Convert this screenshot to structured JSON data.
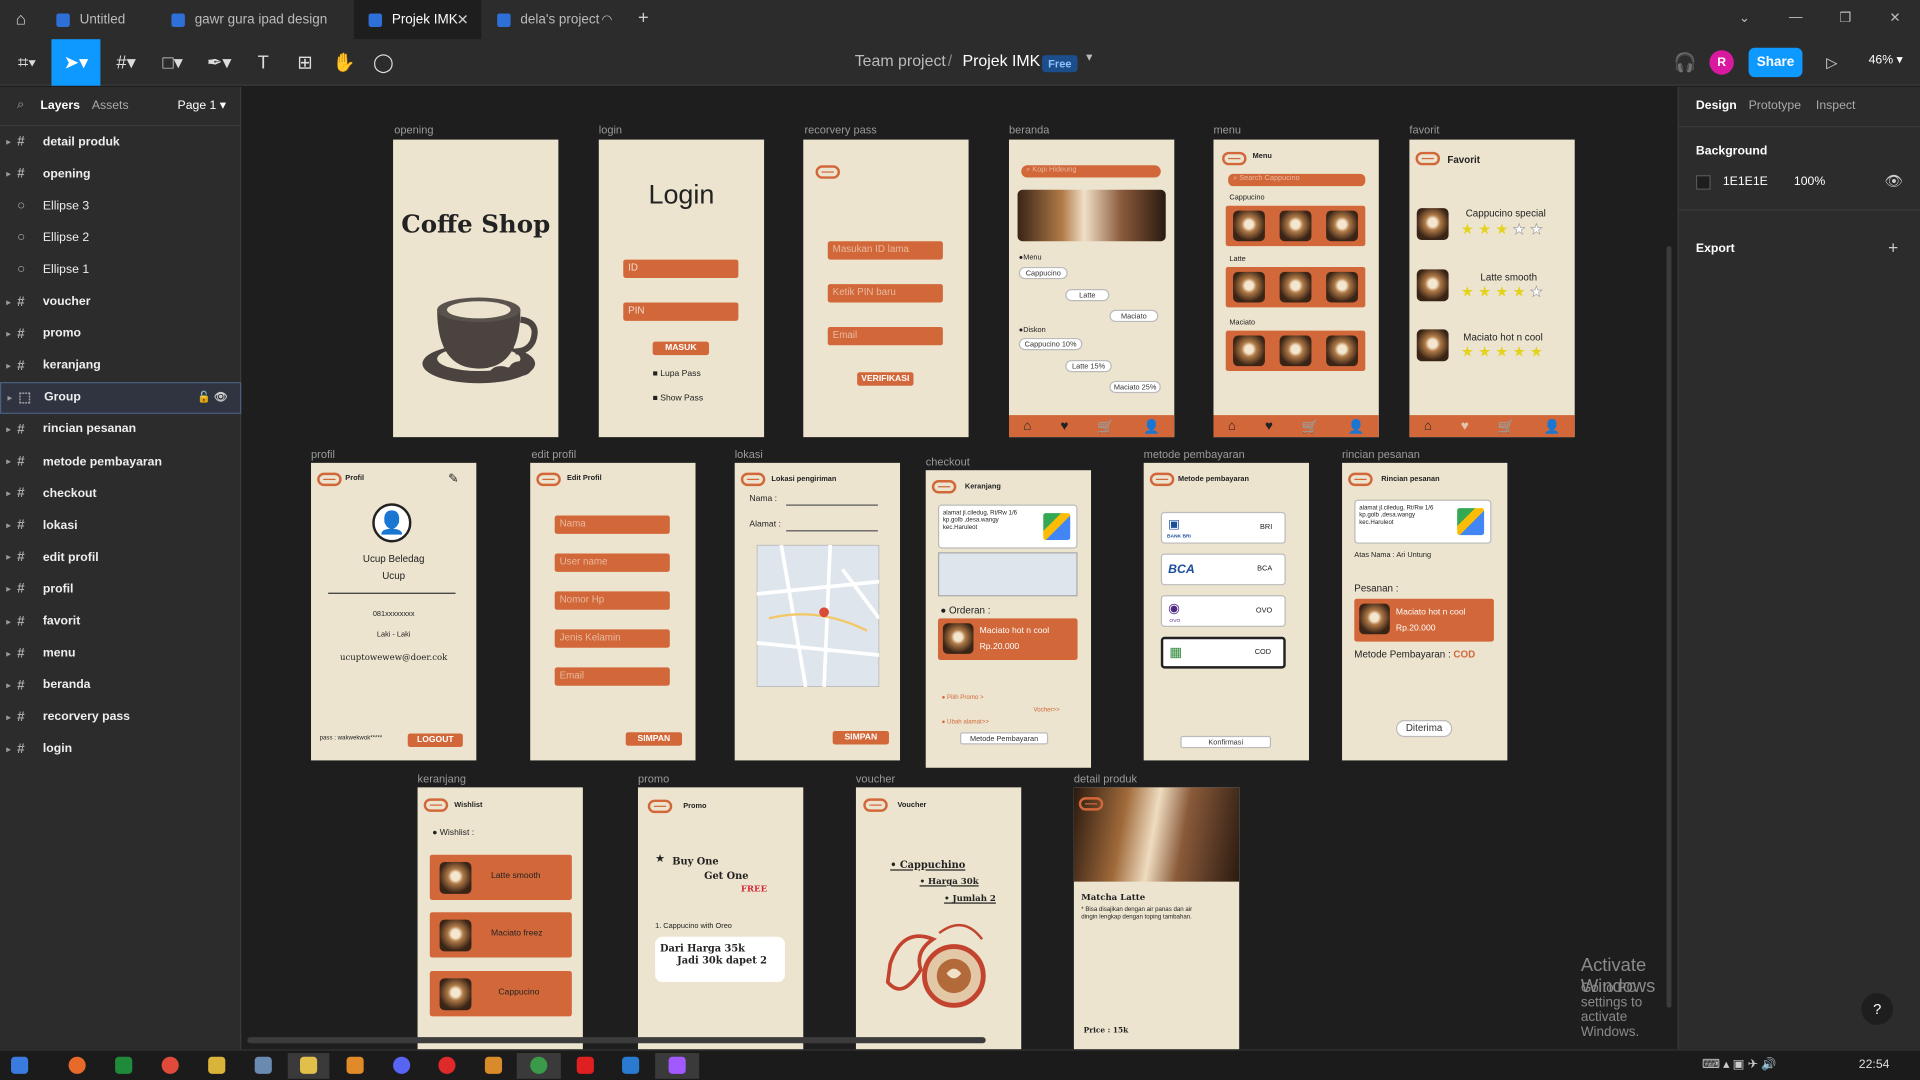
{
  "browser": {
    "tabs": [
      {
        "label": "Untitled"
      },
      {
        "label": "gawr gura ipad design"
      },
      {
        "label": "Projek IMK"
      },
      {
        "label": "dela's project"
      }
    ],
    "new_tab": "+"
  },
  "toolbar": {
    "team": "Team project",
    "separator": "/",
    "file": "Projek IMK",
    "plan": "Free",
    "avatar_initial": "R",
    "share": "Share",
    "zoom": "46%"
  },
  "left_panel": {
    "tabs": [
      "Layers",
      "Assets"
    ],
    "page": "Page 1",
    "layers": [
      {
        "name": "detail produk",
        "type": "frame"
      },
      {
        "name": "opening",
        "type": "frame"
      },
      {
        "name": "Ellipse 3",
        "type": "ellipse"
      },
      {
        "name": "Ellipse 2",
        "type": "ellipse"
      },
      {
        "name": "Ellipse 1",
        "type": "ellipse"
      },
      {
        "name": "voucher",
        "type": "frame"
      },
      {
        "name": "promo",
        "type": "frame"
      },
      {
        "name": "keranjang",
        "type": "frame"
      },
      {
        "name": "Group",
        "type": "group"
      },
      {
        "name": "rincian pesanan",
        "type": "frame"
      },
      {
        "name": "metode pembayaran",
        "type": "frame"
      },
      {
        "name": "checkout",
        "type": "frame"
      },
      {
        "name": "lokasi",
        "type": "frame"
      },
      {
        "name": "edit profil",
        "type": "frame"
      },
      {
        "name": "profil",
        "type": "frame"
      },
      {
        "name": "favorit",
        "type": "frame"
      },
      {
        "name": "menu",
        "type": "frame"
      },
      {
        "name": "beranda",
        "type": "frame"
      },
      {
        "name": "recorvery pass",
        "type": "frame"
      },
      {
        "name": "login",
        "type": "frame"
      }
    ]
  },
  "right_panel": {
    "tabs": [
      "Design",
      "Prototype",
      "Inspect"
    ],
    "background_label": "Background",
    "background_hex": "1E1E1E",
    "background_opacity": "100%",
    "export_label": "Export"
  },
  "frames": {
    "opening": {
      "label": "opening",
      "title": "Coffe Shop"
    },
    "login": {
      "label": "login",
      "title": "Login",
      "id": "ID",
      "pin": "PIN",
      "button": "MASUK",
      "forgot": "Lupa Pass",
      "show": "Show Pass"
    },
    "recovery": {
      "label": "recorvery pass",
      "f1": "Masukan ID lama",
      "f2": "Ketik PIN baru",
      "f3": "Email",
      "button": "VERIFIKASI"
    },
    "beranda": {
      "label": "beranda",
      "search": "Kopi Hideung",
      "menu": "●Menu",
      "p1": "Cappucino",
      "p2": "Latte",
      "p3": "Maciato",
      "diskon": "●Diskon",
      "d1": "Cappucino 10%",
      "d2": "Latte 15%",
      "d3": "Maciato 25%"
    },
    "menu": {
      "label": "menu",
      "title": "Menu",
      "search": "Search Cappucino",
      "c1": "Cappucino",
      "c2": "Latte",
      "c3": "Maciato"
    },
    "favorit": {
      "label": "favorit",
      "title": "Favorit",
      "i1": "Cappucino special",
      "i2": "Latte smooth",
      "i3": "Maciato hot n cool"
    },
    "profil": {
      "label": "profil",
      "title": "Profil",
      "name": "Ucup Beledag",
      "nick": "Ucup",
      "phone": "081xxxxxxxx",
      "gender": "Laki - Laki",
      "email": "ucuptowewew@doer.cok",
      "pass": "pass : wakwekwok*****",
      "button": "LOGOUT"
    },
    "edit": {
      "label": "edit profil",
      "title": "Edit Profil",
      "f1": "Nama",
      "f2": "User name",
      "f3": "Nomor Hp",
      "f4": "Jenis Kelamin",
      "f5": "Email",
      "button": "SIMPAN"
    },
    "lokasi": {
      "label": "lokasi",
      "title": "Lokasi pengiriman",
      "nama": "Nama :",
      "alamat": "Alamat :",
      "button": "SIMPAN"
    },
    "checkout": {
      "label": "checkout",
      "title": "Keranjang",
      "addr": "alamat jl.ciledug, Rt/Rw 1/6 kp.golb ,desa.wangy kec.Haruleot",
      "orderan": "● Orderan :",
      "item": "Maciato hot n cool",
      "price": "Rp.20.000",
      "promo": "● Pilih Promo >",
      "voucher": "Vocher>>",
      "ubah": "● Ubah alamat>>",
      "button": "Metode Pembayaran"
    },
    "metode": {
      "label": "metode pembayaran",
      "title": "Metode pembayaran",
      "bri": "BRI",
      "bank_bri": "BANK BRI",
      "bca_logo": "BCA",
      "bca": "BCA",
      "ovo_logo": "OVO",
      "ovo": "OVO",
      "cod": "COD",
      "button": "Konfirmasi"
    },
    "rincian": {
      "label": "rincian pesanan",
      "title": "Rincian pesanan",
      "addr": "alamat jl.ciledug, Rt/Rw 1/6 kp.golb ,desa.wangy kec.Haruleot",
      "atas": "Atas Nama : Ari Untung",
      "pesanan": "Pesanan :",
      "item": "Maciato hot n cool",
      "price": "Rp.20.000",
      "metode": "Metode Pembayaran :",
      "cod": "COD",
      "button": "Diterima"
    },
    "keranjang": {
      "label": "keranjang",
      "title": "Wishlist",
      "wl": "● Wishlist :",
      "i1": "Latte smooth",
      "i2": "Maciato freez",
      "i3": "Cappucino"
    },
    "promo": {
      "label": "promo",
      "title": "Promo",
      "l1": "Buy One",
      "l2": "Get One",
      "free": "FREE",
      "item": "1. Cappucino with Oreo",
      "d1": "Dari Harga 35k",
      "d2": "Jadi 30k dapet 2"
    },
    "voucher": {
      "label": "voucher",
      "title": "Voucher",
      "v1": "• Cappuchino",
      "v2": "• Harga 30k",
      "v3": "• Jumlah 2"
    },
    "detail": {
      "label": "detail produk",
      "name": "Matcha Latte",
      "desc": "* Bisa disajikan dengan air panas dan air dingin lengkap dengan toping tambahan.",
      "price": "Price : 15k"
    }
  },
  "watermark": {
    "line1": "Activate Windows",
    "line2": "Go to PC settings to activate Windows."
  },
  "help": "?",
  "clock": "22:54",
  "colors": {
    "accent": "#0d99ff",
    "frame_bg": "#ece4cf",
    "orange": "#d2683a",
    "brown": "#5a4a3f"
  }
}
